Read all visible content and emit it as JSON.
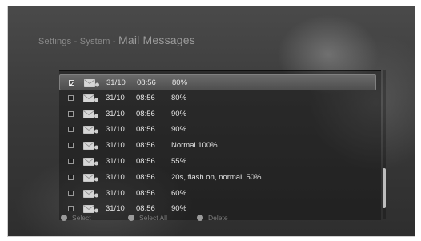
{
  "header": {
    "breadcrumb": "Settings - System - ",
    "title": "Mail Messages"
  },
  "messages": [
    {
      "date": "31/10",
      "time": "08:56",
      "text": "80%",
      "checked": true,
      "selected": true
    },
    {
      "date": "31/10",
      "time": "08:56",
      "text": "80%",
      "checked": false,
      "selected": false
    },
    {
      "date": "31/10",
      "time": "08:56",
      "text": "90%",
      "checked": false,
      "selected": false
    },
    {
      "date": "31/10",
      "time": "08:56",
      "text": "90%",
      "checked": false,
      "selected": false
    },
    {
      "date": "31/10",
      "time": "08:56",
      "text": "Normal 100%",
      "checked": false,
      "selected": false
    },
    {
      "date": "31/10",
      "time": "08:56",
      "text": "55%",
      "checked": false,
      "selected": false
    },
    {
      "date": "31/10",
      "time": "08:56",
      "text": "20s, flash on, normal, 50%",
      "checked": false,
      "selected": false
    },
    {
      "date": "31/10",
      "time": "08:56",
      "text": "60%",
      "checked": false,
      "selected": false
    },
    {
      "date": "31/10",
      "time": "08:56",
      "text": "90%",
      "checked": false,
      "selected": false
    }
  ],
  "footer": {
    "select_label": "Select",
    "select_all_label": "Select All",
    "delete_label": "Delete"
  },
  "icons": {
    "row_icon": "mail-icon",
    "button_dot": "remote-key-dot-icon"
  }
}
